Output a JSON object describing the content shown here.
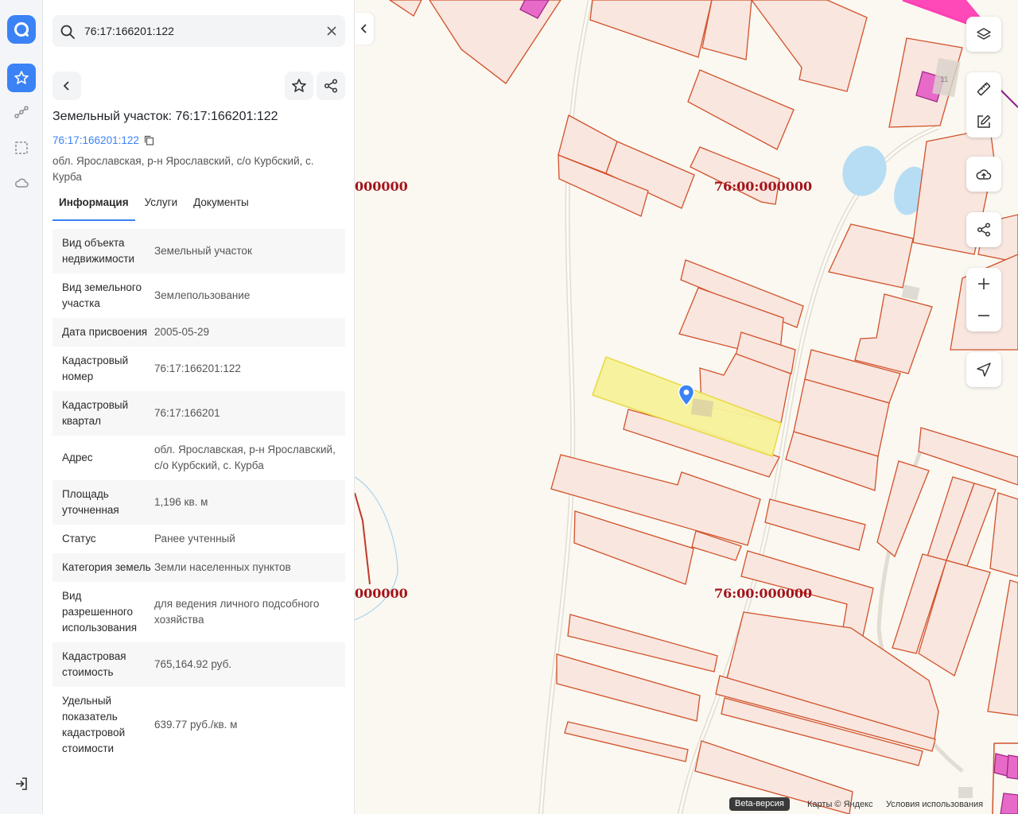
{
  "search": {
    "value": "76:17:166201:122"
  },
  "object": {
    "title": "Земельный участок: 76:17:166201:122",
    "cad_link": "76:17:166201:122",
    "address": "обл. Ярославская, р-н Ярославский, с/о Курбский, с. Курба"
  },
  "tabs": [
    {
      "label": "Информация"
    },
    {
      "label": "Услуги"
    },
    {
      "label": "Документы"
    }
  ],
  "info": [
    {
      "k": "Вид объекта недвижимости",
      "v": "Земельный участок"
    },
    {
      "k": "Вид земельного участка",
      "v": "Землепользование"
    },
    {
      "k": "Дата присвоения",
      "v": "2005-05-29"
    },
    {
      "k": "Кадастровый номер",
      "v": "76:17:166201:122"
    },
    {
      "k": "Кадастровый квартал",
      "v": "76:17:166201"
    },
    {
      "k": "Адрес",
      "v": "обл. Ярославская, р-н Ярославский, с/о Курбский, с. Курба"
    },
    {
      "k": "Площадь уточненная",
      "v": "1,196 кв. м"
    },
    {
      "k": "Статус",
      "v": "Ранее учтенный"
    },
    {
      "k": "Категория земель",
      "v": "Земли населенных пунктов"
    },
    {
      "k": "Вид разрешенного использования",
      "v": "для ведения личного подсобного хозяйства"
    },
    {
      "k": "Кадастровая стоимость",
      "v": "765,164.92 руб."
    },
    {
      "k": "Удельный показатель кадастровой стоимости",
      "v": "639.77 руб./кв. м"
    }
  ],
  "map": {
    "labels": [
      "000000",
      "76:00:000000",
      "000000",
      "76:00:000000"
    ],
    "house_number": "11"
  },
  "footer": {
    "beta": "Beta-версия",
    "copyright": "Карты © Яндекс",
    "terms": "Условия использования"
  },
  "colors": {
    "accent": "#3b82f6",
    "parcel_stroke": "#d2512a",
    "parcel_fill": "#f8e6df",
    "selected_fill": "#f7f29a",
    "label": "#a3131b",
    "water": "#b7ddf4",
    "magenta": "#ff3fb4"
  }
}
